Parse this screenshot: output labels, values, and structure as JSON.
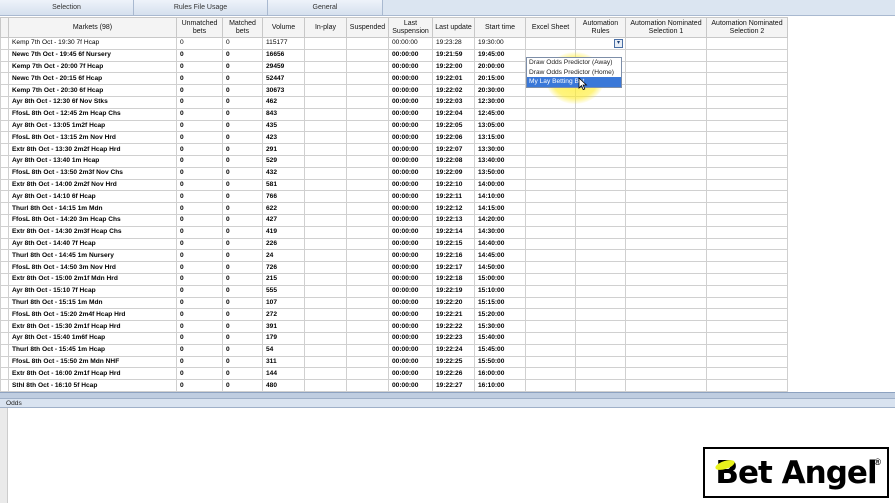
{
  "top_tabs": [
    "Selection",
    "Rules File Usage",
    "General"
  ],
  "columns": [
    "Markets (98)",
    "Unmatched bets",
    "Matched bets",
    "Volume",
    "In-play",
    "Suspended",
    "Last Suspension",
    "Last update",
    "Start time",
    "Excel Sheet",
    "Automation Rules",
    "Automation Nominated Selection 1",
    "Automation Nominated Selection 2"
  ],
  "rows": [
    {
      "market": "Kemp  7th Oct - 19:30 7f Hcap",
      "unmatched": "0",
      "matched": "0",
      "volume": "115177",
      "last_susp": "00:00:00",
      "last_update": "19:23:28",
      "start": "19:30:00"
    },
    {
      "market": "Newc  7th Oct - 19:45 6f Nursery",
      "unmatched": "0",
      "matched": "0",
      "volume": "16656",
      "last_susp": "00:00:00",
      "last_update": "19:21:59",
      "start": "19:45:00"
    },
    {
      "market": "Kemp  7th Oct - 20:00 7f Hcap",
      "unmatched": "0",
      "matched": "0",
      "volume": "29459",
      "last_susp": "00:00:00",
      "last_update": "19:22:00",
      "start": "20:00:00"
    },
    {
      "market": "Newc  7th Oct - 20:15 6f Hcap",
      "unmatched": "0",
      "matched": "0",
      "volume": "52447",
      "last_susp": "00:00:00",
      "last_update": "19:22:01",
      "start": "20:15:00"
    },
    {
      "market": "Kemp  7th Oct - 20:30 6f Hcap",
      "unmatched": "0",
      "matched": "0",
      "volume": "30673",
      "last_susp": "00:00:00",
      "last_update": "19:22:02",
      "start": "20:30:00"
    },
    {
      "market": "Ayr  8th Oct - 12:30 6f Nov Stks",
      "unmatched": "0",
      "matched": "0",
      "volume": "462",
      "last_susp": "00:00:00",
      "last_update": "19:22:03",
      "start": "12:30:00"
    },
    {
      "market": "FfosL  8th Oct - 12:45 2m Hcap Chs",
      "unmatched": "0",
      "matched": "0",
      "volume": "843",
      "last_susp": "00:00:00",
      "last_update": "19:22:04",
      "start": "12:45:00"
    },
    {
      "market": "Ayr  8th Oct - 13:05 1m2f Hcap",
      "unmatched": "0",
      "matched": "0",
      "volume": "435",
      "last_susp": "00:00:00",
      "last_update": "19:22:05",
      "start": "13:05:00"
    },
    {
      "market": "FfosL  8th Oct - 13:15 2m Nov Hrd",
      "unmatched": "0",
      "matched": "0",
      "volume": "423",
      "last_susp": "00:00:00",
      "last_update": "19:22:06",
      "start": "13:15:00"
    },
    {
      "market": "Extr  8th Oct - 13:30 2m2f Hcap Hrd",
      "unmatched": "0",
      "matched": "0",
      "volume": "291",
      "last_susp": "00:00:00",
      "last_update": "19:22:07",
      "start": "13:30:00"
    },
    {
      "market": "Ayr  8th Oct - 13:40 1m Hcap",
      "unmatched": "0",
      "matched": "0",
      "volume": "529",
      "last_susp": "00:00:00",
      "last_update": "19:22:08",
      "start": "13:40:00"
    },
    {
      "market": "FfosL  8th Oct - 13:50 2m3f Nov Chs",
      "unmatched": "0",
      "matched": "0",
      "volume": "432",
      "last_susp": "00:00:00",
      "last_update": "19:22:09",
      "start": "13:50:00"
    },
    {
      "market": "Extr  8th Oct - 14:00 2m2f Nov Hrd",
      "unmatched": "0",
      "matched": "0",
      "volume": "581",
      "last_susp": "00:00:00",
      "last_update": "19:22:10",
      "start": "14:00:00"
    },
    {
      "market": "Ayr  8th Oct - 14:10 6f Hcap",
      "unmatched": "0",
      "matched": "0",
      "volume": "766",
      "last_susp": "00:00:00",
      "last_update": "19:22:11",
      "start": "14:10:00"
    },
    {
      "market": "Thurl  8th Oct - 14:15 1m Mdn",
      "unmatched": "0",
      "matched": "0",
      "volume": "622",
      "last_susp": "00:00:00",
      "last_update": "19:22:12",
      "start": "14:15:00"
    },
    {
      "market": "FfosL  8th Oct - 14:20 3m Hcap Chs",
      "unmatched": "0",
      "matched": "0",
      "volume": "427",
      "last_susp": "00:00:00",
      "last_update": "19:22:13",
      "start": "14:20:00"
    },
    {
      "market": "Extr  8th Oct - 14:30 2m3f Hcap Chs",
      "unmatched": "0",
      "matched": "0",
      "volume": "419",
      "last_susp": "00:00:00",
      "last_update": "19:22:14",
      "start": "14:30:00"
    },
    {
      "market": "Ayr  8th Oct - 14:40 7f Hcap",
      "unmatched": "0",
      "matched": "0",
      "volume": "226",
      "last_susp": "00:00:00",
      "last_update": "19:22:15",
      "start": "14:40:00"
    },
    {
      "market": "Thurl  8th Oct - 14:45 1m Nursery",
      "unmatched": "0",
      "matched": "0",
      "volume": "24",
      "last_susp": "00:00:00",
      "last_update": "19:22:16",
      "start": "14:45:00"
    },
    {
      "market": "FfosL  8th Oct - 14:50 3m Nov Hrd",
      "unmatched": "0",
      "matched": "0",
      "volume": "726",
      "last_susp": "00:00:00",
      "last_update": "19:22:17",
      "start": "14:50:00"
    },
    {
      "market": "Extr  8th Oct - 15:00 2m1f Mdn Hrd",
      "unmatched": "0",
      "matched": "0",
      "volume": "215",
      "last_susp": "00:00:00",
      "last_update": "19:22:18",
      "start": "15:00:00"
    },
    {
      "market": "Ayr  8th Oct - 15:10 7f Hcap",
      "unmatched": "0",
      "matched": "0",
      "volume": "555",
      "last_susp": "00:00:00",
      "last_update": "19:22:19",
      "start": "15:10:00"
    },
    {
      "market": "Thurl  8th Oct - 15:15 1m Mdn",
      "unmatched": "0",
      "matched": "0",
      "volume": "107",
      "last_susp": "00:00:00",
      "last_update": "19:22:20",
      "start": "15:15:00"
    },
    {
      "market": "FfosL  8th Oct - 15:20 2m4f Hcap Hrd",
      "unmatched": "0",
      "matched": "0",
      "volume": "272",
      "last_susp": "00:00:00",
      "last_update": "19:22:21",
      "start": "15:20:00"
    },
    {
      "market": "Extr  8th Oct - 15:30 2m1f Hcap Hrd",
      "unmatched": "0",
      "matched": "0",
      "volume": "391",
      "last_susp": "00:00:00",
      "last_update": "19:22:22",
      "start": "15:30:00"
    },
    {
      "market": "Ayr  8th Oct - 15:40 1m6f Hcap",
      "unmatched": "0",
      "matched": "0",
      "volume": "179",
      "last_susp": "00:00:00",
      "last_update": "19:22:23",
      "start": "15:40:00"
    },
    {
      "market": "Thurl  8th Oct - 15:45 1m Hcap",
      "unmatched": "0",
      "matched": "0",
      "volume": "54",
      "last_susp": "00:00:00",
      "last_update": "19:22:24",
      "start": "15:45:00"
    },
    {
      "market": "FfosL  8th Oct - 15:50 2m Mdn NHF",
      "unmatched": "0",
      "matched": "0",
      "volume": "311",
      "last_susp": "00:00:00",
      "last_update": "19:22:25",
      "start": "15:50:00"
    },
    {
      "market": "Extr  8th Oct - 16:00 2m1f Hcap Hrd",
      "unmatched": "0",
      "matched": "0",
      "volume": "144",
      "last_susp": "00:00:00",
      "last_update": "19:22:26",
      "start": "16:00:00"
    },
    {
      "market": "Sthl  8th Oct - 16:10 5f Hcap",
      "unmatched": "0",
      "matched": "0",
      "volume": "480",
      "last_susp": "00:00:00",
      "last_update": "19:22:27",
      "start": "16:10:00"
    }
  ],
  "dropdown": {
    "options": [
      "Draw Odds Predictor (Away)",
      "Draw Odds Predictor (Home)",
      "My Lay Betting Bot"
    ],
    "selected_index": 2
  },
  "odds_panel": {
    "title": "Odds"
  },
  "logo": {
    "text": "Bet Angel",
    "mark": "®"
  },
  "colors": {
    "accent": "#3a78d8",
    "highlight": "#f5ea2a",
    "header_bg": "#dbe5f1"
  }
}
